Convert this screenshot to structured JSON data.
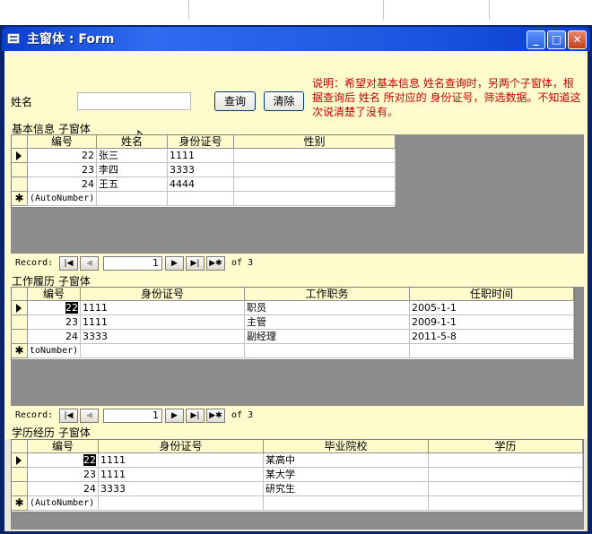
{
  "window": {
    "title": "主窗体 : Form"
  },
  "title_buttons": {
    "minimize": "_",
    "maximize": "□",
    "close": "✕"
  },
  "search": {
    "label": "姓名",
    "input_value": "",
    "query_button": "查询",
    "clear_button": "清除"
  },
  "note": "说明：希望对基本信息 姓名查询时，另两个子窗体，根据查询后 姓名 所对应的 身份证号，筛选数据。不知道这次说清楚了没有。",
  "basic": {
    "label": "基本信息 子窗体",
    "columns": [
      "编号",
      "姓名",
      "身份证号",
      "性别"
    ],
    "rows": [
      {
        "id": "22",
        "name": "张三",
        "idcard": "1111",
        "gender": ""
      },
      {
        "id": "23",
        "name": "李四",
        "idcard": "3333",
        "gender": ""
      },
      {
        "id": "24",
        "name": "王五",
        "idcard": "4444",
        "gender": ""
      }
    ],
    "new_row": "(AutoNumber)",
    "nav": {
      "record_label": "Record:",
      "current": "1",
      "of_label": "of",
      "total": "3"
    }
  },
  "work": {
    "label": "工作履历 子窗体",
    "columns": [
      "编号",
      "身份证号",
      "工作职务",
      "任职时间"
    ],
    "rows": [
      {
        "id": "22",
        "idcard": "1111",
        "position": "职员",
        "date": "2005-1-1"
      },
      {
        "id": "23",
        "idcard": "1111",
        "position": "主管",
        "date": "2009-1-1"
      },
      {
        "id": "24",
        "idcard": "3333",
        "position": "副经理",
        "date": "2011-5-8"
      }
    ],
    "new_row": "toNumber)",
    "nav": {
      "record_label": "Record:",
      "current": "1",
      "of_label": "of",
      "total": "3"
    }
  },
  "edu": {
    "label": "学历经历 子窗体",
    "columns": [
      "编号",
      "身份证号",
      "毕业院校",
      "学历"
    ],
    "rows": [
      {
        "id": "22",
        "idcard": "1111",
        "school": "某高中",
        "degree": ""
      },
      {
        "id": "23",
        "idcard": "1111",
        "school": "某大学",
        "degree": ""
      },
      {
        "id": "24",
        "idcard": "3333",
        "school": "研究生",
        "degree": ""
      }
    ],
    "new_row": "(AutoNumber)"
  },
  "nav_icons": {
    "first": "first-record-icon",
    "prev": "prev-record-icon",
    "next": "next-record-icon",
    "last": "last-record-icon",
    "new": "new-record-icon"
  },
  "colors": {
    "titlebar": "#2f6cf0",
    "panel": "#fefccd",
    "note": "#cc0000",
    "grid_empty": "#8c8c8c"
  }
}
